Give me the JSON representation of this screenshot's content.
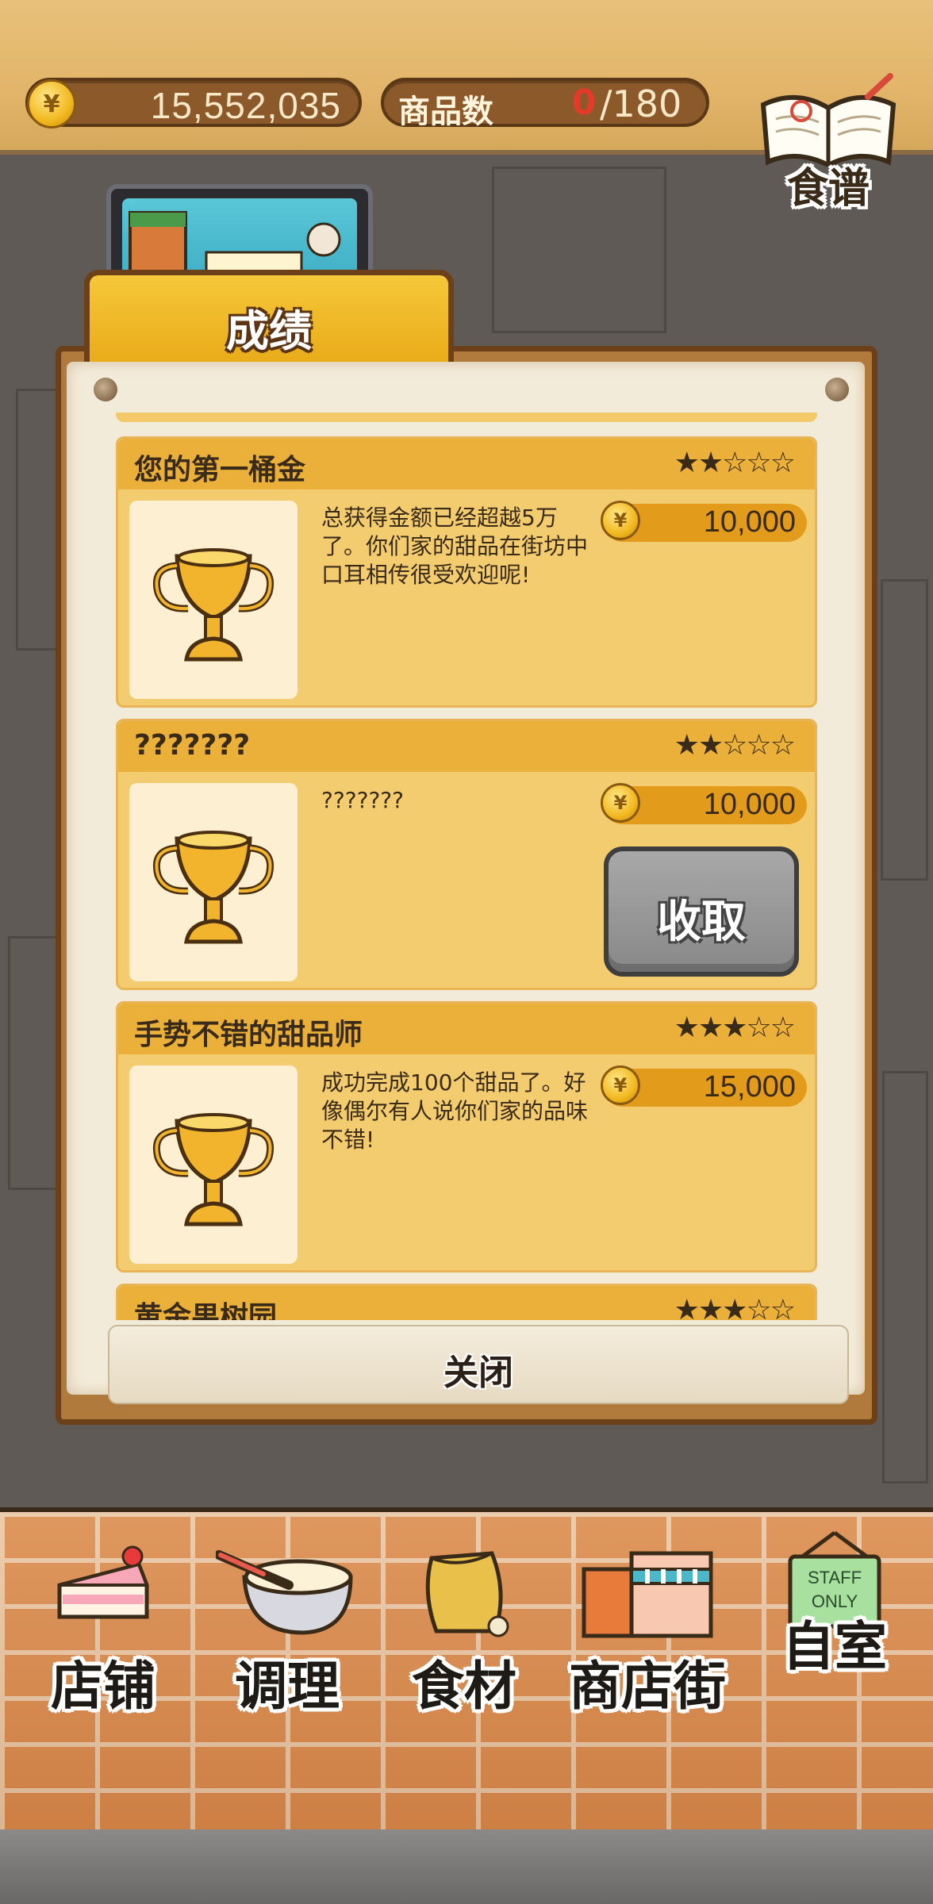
{
  "header": {
    "money": "15,552,035",
    "currency_symbol": "¥",
    "item_count_label": "商品数",
    "item_count_current": "0",
    "item_count_max": "/180",
    "recipe_label": "食谱"
  },
  "panel": {
    "tab_title": "成绩",
    "close_label": "关闭"
  },
  "achievements": [
    {
      "title": "您的第一桶金",
      "stars": "★★☆☆☆",
      "description": "总获得金额已经超越5万了。你们家的甜品在街坊中口耳相传很受欢迎呢!",
      "reward": "10,000"
    },
    {
      "title": "???????",
      "stars": "★★☆☆☆",
      "description": "???????",
      "reward": "10,000",
      "collect_label": "收取"
    },
    {
      "title": "手势不错的甜品师",
      "stars": "★★★☆☆",
      "description": "成功完成100个甜品了。好像偶尔有人说你们家的品味不错!",
      "reward": "15,000"
    },
    {
      "title": "黄金果树园",
      "stars": "★★★☆☆"
    }
  ],
  "nav": {
    "shop": "店铺",
    "cook": "调理",
    "ingredients": "食材",
    "street": "商店街",
    "room": "自室",
    "staff_sign": "STAFF ONLY"
  },
  "colors": {
    "accent": "#eab03a",
    "card": "#f4cc70",
    "brick": "#d98a4c",
    "collect_button": "#999999"
  }
}
